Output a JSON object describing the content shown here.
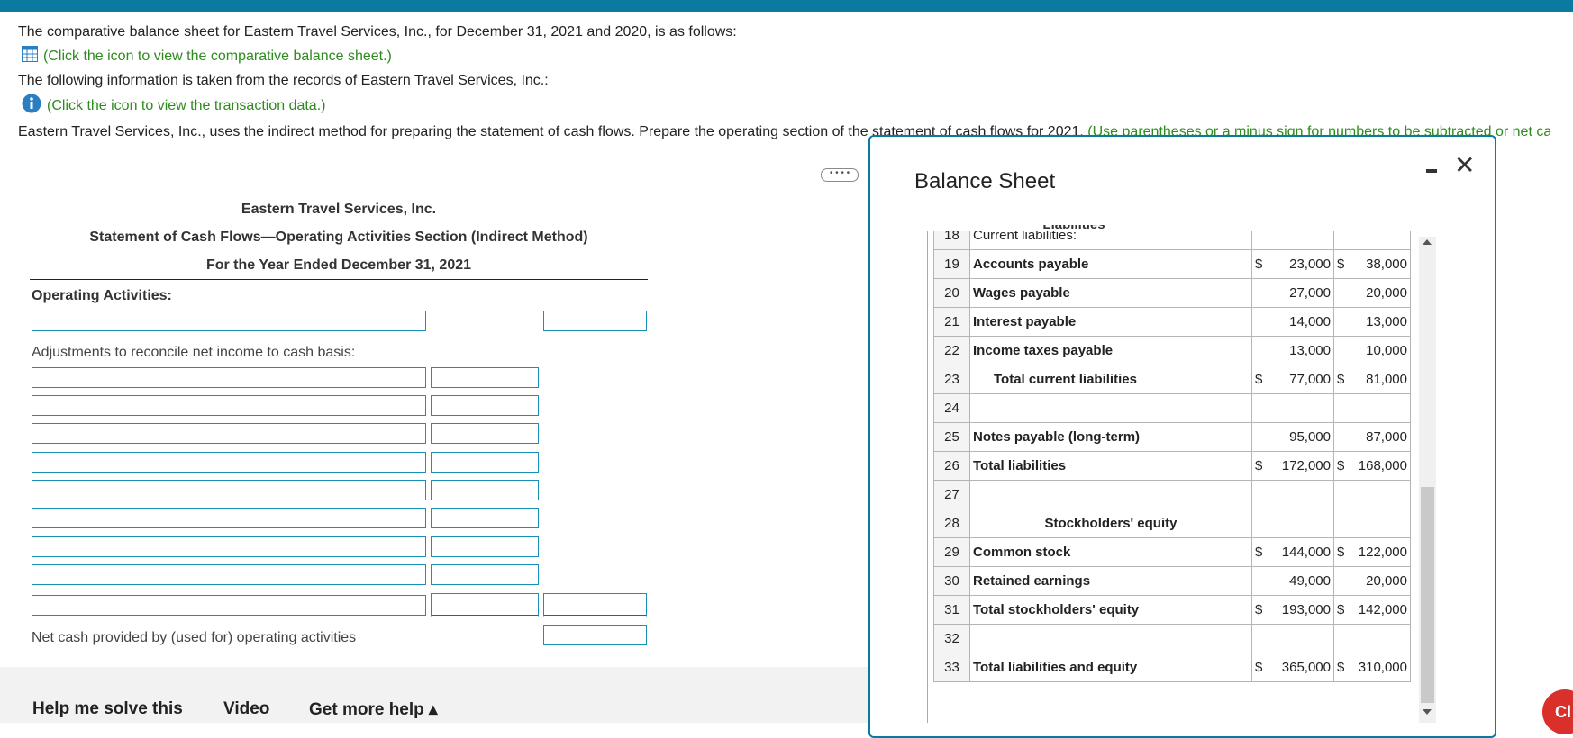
{
  "intro": {
    "line1": "The comparative balance sheet for Eastern Travel Services, Inc., for December 31, 2021 and 2020, is as follows:",
    "link1": "(Click the icon to view the comparative balance sheet.)",
    "line2": "The following information is taken from the records of Eastern Travel Services, Inc.:",
    "link2": "(Click the icon to view the transaction data.)",
    "line3_start": "Eastern Travel Services, Inc., uses the indirect method for preparing the statement of cash flows. Prepare the operating section of the statement of cash flows for 2021.",
    "line3_hint": "(Use parentheses or a minus sign for numbers to be subtracted or net ca"
  },
  "more_button": "• • • •",
  "statement": {
    "company": "Eastern Travel Services, Inc.",
    "title": "Statement of Cash Flows—Operating Activities Section (Indirect Method)",
    "period": "For the Year Ended December 31, 2021",
    "operating_label": "Operating Activities:",
    "adjustments_label": "Adjustments to reconcile net income to cash basis:",
    "net_cash_label": "Net cash provided by (used for) operating activities"
  },
  "footer": {
    "help": "Help me solve this",
    "video": "Video",
    "more_help": "Get more help ▴"
  },
  "modal": {
    "title": "Balance Sheet",
    "partial_header": "Liabilities",
    "rows": [
      {
        "num": "18",
        "label": "Current liabilities:",
        "style": "plain",
        "v1": "",
        "v2": "",
        "s1": "",
        "s2": ""
      },
      {
        "num": "19",
        "label": "Accounts payable",
        "style": "b",
        "s1": "$",
        "v1": "23,000",
        "s2": "$",
        "v2": "38,000"
      },
      {
        "num": "20",
        "label": "Wages payable",
        "style": "b",
        "s1": "",
        "v1": "27,000",
        "s2": "",
        "v2": "20,000"
      },
      {
        "num": "21",
        "label": "Interest payable",
        "style": "b",
        "s1": "",
        "v1": "14,000",
        "s2": "",
        "v2": "13,000"
      },
      {
        "num": "22",
        "label": "Income taxes payable",
        "style": "b",
        "s1": "",
        "v1": "13,000",
        "s2": "",
        "v2": "10,000"
      },
      {
        "num": "23",
        "label": "Total current liabilities",
        "style": "ind",
        "s1": "$",
        "v1": "77,000",
        "s2": "$",
        "v2": "81,000"
      },
      {
        "num": "24",
        "label": "",
        "style": "plain",
        "s1": "",
        "v1": "",
        "s2": "",
        "v2": ""
      },
      {
        "num": "25",
        "label": "Notes payable (long-term)",
        "style": "b",
        "s1": "",
        "v1": "95,000",
        "s2": "",
        "v2": "87,000"
      },
      {
        "num": "26",
        "label": "Total liabilities",
        "style": "b",
        "s1": "$",
        "v1": "172,000",
        "s2": "$",
        "v2": "168,000"
      },
      {
        "num": "27",
        "label": "",
        "style": "plain",
        "s1": "",
        "v1": "",
        "s2": "",
        "v2": ""
      },
      {
        "num": "28",
        "label": "Stockholders' equity",
        "style": "ctr",
        "s1": "",
        "v1": "",
        "s2": "",
        "v2": ""
      },
      {
        "num": "29",
        "label": "Common stock",
        "style": "b",
        "s1": "$",
        "v1": "144,000",
        "s2": "$",
        "v2": "122,000"
      },
      {
        "num": "30",
        "label": "Retained earnings",
        "style": "b",
        "s1": "",
        "v1": "49,000",
        "s2": "",
        "v2": "20,000"
      },
      {
        "num": "31",
        "label": "Total stockholders' equity",
        "style": "b",
        "s1": "$",
        "v1": "193,000",
        "s2": "$",
        "v2": "142,000"
      },
      {
        "num": "32",
        "label": "",
        "style": "plain",
        "s1": "",
        "v1": "",
        "s2": "",
        "v2": ""
      },
      {
        "num": "33",
        "label": "Total liabilities and equity",
        "style": "b",
        "s1": "$",
        "v1": "365,000",
        "s2": "$",
        "v2": "310,000"
      }
    ]
  },
  "chat_button": "Cl",
  "colors": {
    "accent": "#0b7aa1",
    "link_green": "#2e8b1e",
    "input_border": "#1a8fb8"
  }
}
